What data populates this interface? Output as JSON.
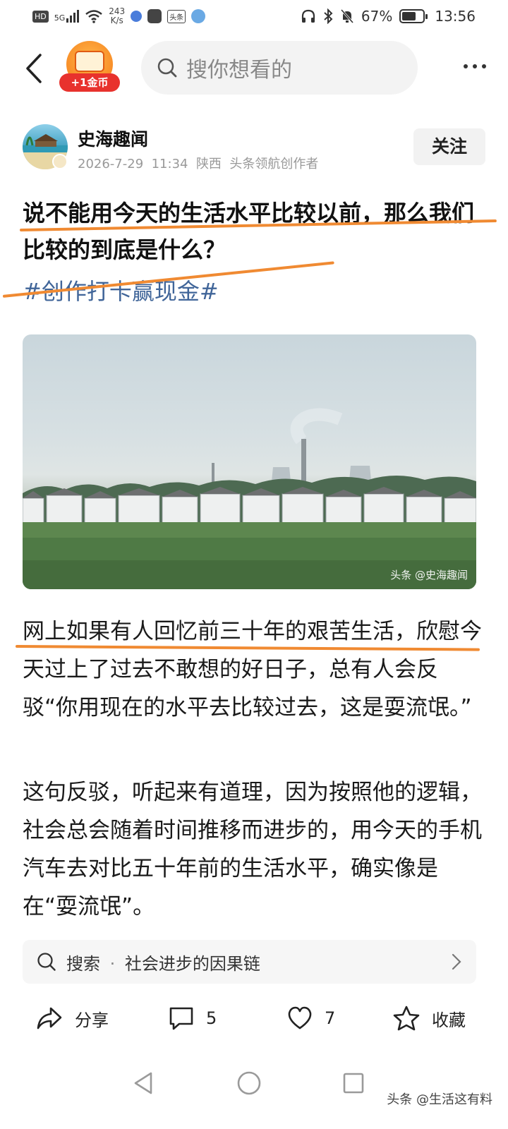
{
  "status_bar": {
    "hd": "HD",
    "signal_label": "5G",
    "net_speed_value": "243",
    "net_speed_unit": "K/s",
    "app_icon_label": "头条",
    "battery": "67%",
    "time": "13:56",
    "battery_level": 0.67
  },
  "topnav": {
    "coin_label": "+1金币",
    "search_placeholder": "搜你想看的"
  },
  "author": {
    "name": "史海趣闻",
    "date": "2026-7-29",
    "time": "11:34",
    "location": "陕西",
    "badge": "头条领航创作者",
    "follow_label": "关注"
  },
  "article": {
    "title": "说不能用今天的生活水平比较以前，那么我们比较的到底是什么？",
    "hashtag": "#创作打卡赢现金#",
    "image_watermark": "头条 @史海趣闻",
    "paragraphs": [
      "网上如果有人回忆前三十年的艰苦生活，欣慰今天过上了过去不敢想的好日子，总有人会反驳“你用现在的水平去比较过去，这是耍流氓。”",
      "这句反驳，听起来有道理，因为按照他的逻辑，社会总会随着时间推移而进步的，用今天的手机汽车去对比五十年前的生活水平，确实像是在“耍流氓”。"
    ]
  },
  "search_suggestion": {
    "label": "搜索",
    "separator": "·",
    "query": "社会进步的因果链"
  },
  "actions": {
    "share_label": "分享",
    "comment_count": "5",
    "like_count": "7",
    "favorite_label": "收藏"
  },
  "footer": {
    "watermark": "头条 @生活这有料"
  },
  "colors": {
    "annotation_orange": "#f08a32",
    "hashtag_blue": "#406599",
    "coin_red": "#e8322d"
  }
}
